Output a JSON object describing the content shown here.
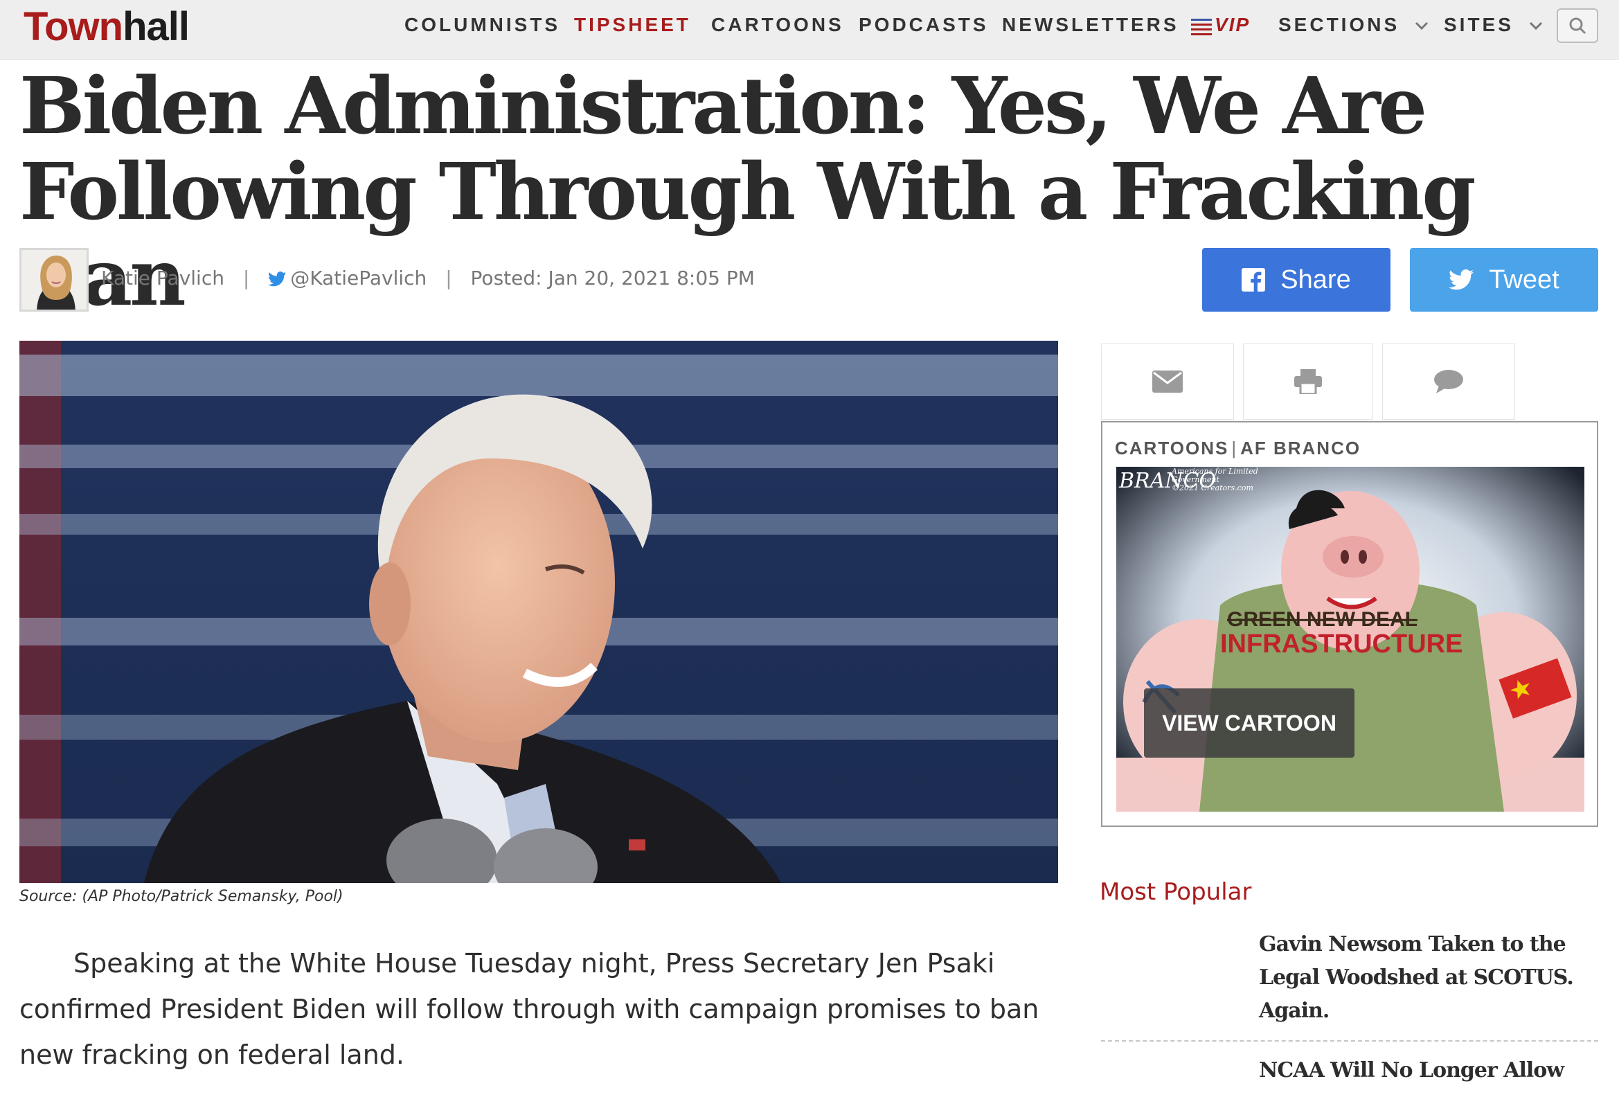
{
  "site": {
    "logo_part1": "Town",
    "logo_part2": "hall",
    "brand_red": "#a81c1c"
  },
  "nav": {
    "items": [
      {
        "label": "COLUMNISTS"
      },
      {
        "label": "TIPSHEET"
      },
      {
        "label": "CARTOONS"
      },
      {
        "label": "PODCASTS"
      },
      {
        "label": "NEWSLETTERS"
      },
      {
        "label": "VIP"
      },
      {
        "label": "SECTIONS"
      },
      {
        "label": "SITES"
      }
    ],
    "search_icon": "search-icon"
  },
  "article": {
    "headline": "Biden Administration: Yes, We Are Following Through With a Fracking Ban",
    "author": "Katie Pavlich",
    "twitter_handle": "@KatiePavlich",
    "posted": "Posted: Jan 20, 2021 8:05 PM",
    "photo_caption": "Source: (AP Photo/Patrick Semansky, Pool)",
    "body": "Speaking at the White House Tuesday night, Press Secretary Jen Psaki confirmed President Biden will follow through with campaign promises to ban new fracking on federal land."
  },
  "share": {
    "facebook_label": "Share",
    "twitter_label": "Tweet",
    "facebook_color": "#3b75dc",
    "twitter_color": "#4ba3ea"
  },
  "sidebar": {
    "tools": [
      "envelope-icon",
      "printer-icon",
      "comment-icon"
    ],
    "cartoon": {
      "section": "CARTOONS",
      "artist": "AF BRANCO",
      "button_label": "VIEW CARTOON",
      "signature": "BRANCO",
      "credit_line1": "Americans for Limited",
      "credit_line2": "Government",
      "credit_line3": "©2021 Creators.com",
      "shirt_text_strike": "GREEN NEW DEAL",
      "shirt_text": "INFRASTRUCTURE"
    },
    "most_popular_title": "Most Popular",
    "popular": [
      {
        "title": "Gavin Newsom Taken to the Legal Woodshed at SCOTUS. Again."
      },
      {
        "title": "NCAA Will No Longer Allow"
      }
    ]
  }
}
